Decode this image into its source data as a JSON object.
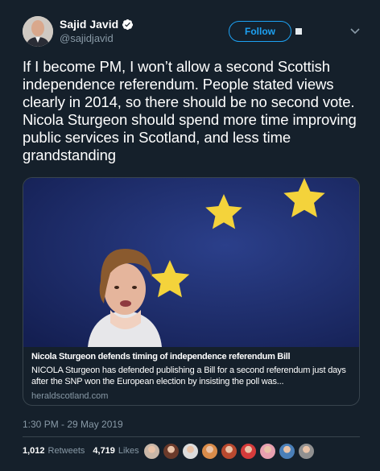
{
  "author": {
    "display_name": "Sajid Javid",
    "handle": "@sajidjavid",
    "verified": true
  },
  "follow_label": "Follow",
  "tweet_text": "If I become PM, I won’t allow a second Scottish independence referendum. People stated views clearly in 2014, so there should be no second vote. Nicola Sturgeon should spend more time improving public services in Scotland, and less time grandstanding",
  "card": {
    "title": "Nicola Sturgeon defends timing of independence referendum Bill",
    "description": "NICOLA Sturgeon has defended publishing a Bill for a second referendum just days after the SNP won the European election by insisting the poll was...",
    "domain": "heraldscotland.com"
  },
  "timestamp": "1:30 PM - 29 May 2019",
  "stats": {
    "retweets_count": "1,012",
    "retweets_label": "Retweets",
    "likes_count": "4,719",
    "likes_label": "Likes"
  },
  "likers": [
    {
      "color": "#c9b7a8"
    },
    {
      "color": "#6b3a2a"
    },
    {
      "color": "#dcdcdc"
    },
    {
      "color": "#d98c4a"
    },
    {
      "color": "#b8492f"
    },
    {
      "color": "#d53b3b"
    },
    {
      "color": "#e8a0b0"
    },
    {
      "color": "#4a7fb8"
    },
    {
      "color": "#909090"
    }
  ],
  "colors": {
    "background": "#15202b",
    "accent": "#1da1f2",
    "muted": "#8899a6",
    "border": "#38444d"
  }
}
